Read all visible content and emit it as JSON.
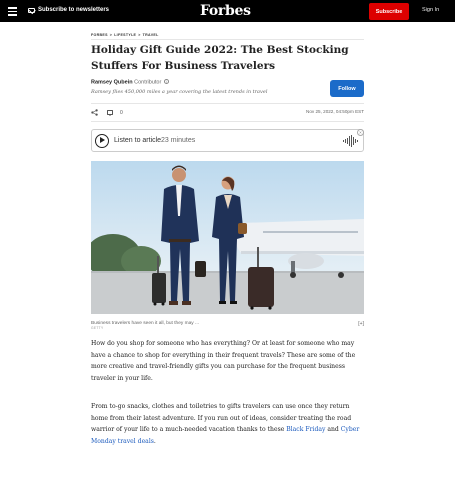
{
  "header": {
    "newsletter_label": "Subscribe to newsletters",
    "logo": "Forbes",
    "subscribe_label": "Subscribe",
    "signin_label": "Sign In"
  },
  "article": {
    "breadcrumb": [
      "FORBES",
      "LIFESTYLE",
      "TRAVEL"
    ],
    "breadcrumb_separator": ">",
    "title": "Holiday Gift Guide 2022: The Best Stocking Stuffers For Business Travelers",
    "author_name": "Ramsey Qubein",
    "author_role": "Contributor",
    "info_glyph": "i",
    "author_bio": "Ramsey flies 450,000 miles a year covering the latest trends in travel",
    "follow_label": "Follow",
    "comment_count": "0",
    "timestamp": "Nov 25, 2022, 04:50pm EST",
    "listen_label": "Listen to article",
    "listen_duration": "23 minutes",
    "close_glyph": "×",
    "image_caption": "Business travelers have seen it all, but they may ...",
    "image_credit": "GETTY",
    "expand_glyph": "[+]",
    "paragraph1": "How do you shop for someone who has everything? Or at least for someone who may have a chance to shop for everything in their frequent travels? These are some of the more creative and travel-friendly gifts you can purchase for the frequent business traveler in your life.",
    "paragraph2_text": "From to-go snacks, clothes and toiletries to gifts travelers can use once they return home from their latest adventure. If you run out of ideas, consider treating the road warrior of your life to a much-needed vacation thanks to these ",
    "link_black_friday": "Black Friday",
    "paragraph2_and": " and ",
    "link_cyber_monday": "Cyber Monday travel deals",
    "paragraph2_end": "."
  },
  "colors": {
    "topbar": "#000000",
    "subscribe_button": "#dd0000",
    "follow_button": "#1b6bc9",
    "link": "#1b5abd"
  },
  "icons": [
    "menu-icon",
    "mail-icon",
    "info-icon",
    "share-icon",
    "comment-icon",
    "play-icon",
    "waveform-icon",
    "close-icon",
    "expand-icon"
  ]
}
